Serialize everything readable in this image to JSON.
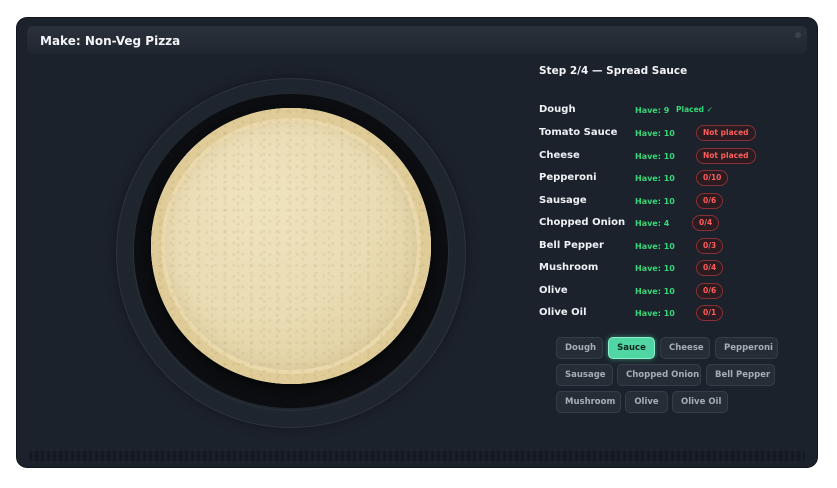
{
  "window": {
    "title": "Make: Non-Veg Pizza"
  },
  "step": {
    "title": "Step 2/4 — Spread Sauce"
  },
  "ingredients": [
    {
      "name": "Dough",
      "have": "Have: 9",
      "status": "Placed ✓",
      "status_kind": "ok"
    },
    {
      "name": "Tomato Sauce",
      "have": "Have: 10",
      "status": "Not placed",
      "status_kind": "bad"
    },
    {
      "name": "Cheese",
      "have": "Have: 10",
      "status": "Not placed",
      "status_kind": "bad"
    },
    {
      "name": "Pepperoni",
      "have": "Have: 10",
      "status": "0/10",
      "status_kind": "bad"
    },
    {
      "name": "Sausage",
      "have": "Have: 10",
      "status": "0/6",
      "status_kind": "bad"
    },
    {
      "name": "Chopped Onion",
      "have": "Have: 4",
      "status": "0/4",
      "status_kind": "bad"
    },
    {
      "name": "Bell Pepper",
      "have": "Have: 10",
      "status": "0/3",
      "status_kind": "bad"
    },
    {
      "name": "Mushroom",
      "have": "Have: 10",
      "status": "0/4",
      "status_kind": "bad"
    },
    {
      "name": "Olive",
      "have": "Have: 10",
      "status": "0/6",
      "status_kind": "bad"
    },
    {
      "name": "Olive Oil",
      "have": "Have: 10",
      "status": "0/1",
      "status_kind": "bad"
    }
  ],
  "tools": [
    {
      "label": "Dough",
      "active": false
    },
    {
      "label": "Sauce",
      "active": true
    },
    {
      "label": "Cheese",
      "active": false
    },
    {
      "label": "Pepperoni",
      "active": false
    },
    {
      "label": "Sausage",
      "active": false
    },
    {
      "label": "Chopped Onion",
      "active": false
    },
    {
      "label": "Bell Pepper",
      "active": false
    },
    {
      "label": "Mushroom",
      "active": false
    },
    {
      "label": "Olive",
      "active": false
    },
    {
      "label": "Olive Oil",
      "active": false
    }
  ],
  "colors": {
    "background": "#1c222b",
    "have_green": "#37d67a",
    "status_red": "#ff5d5d",
    "active_tool": "#4fd6a3"
  }
}
